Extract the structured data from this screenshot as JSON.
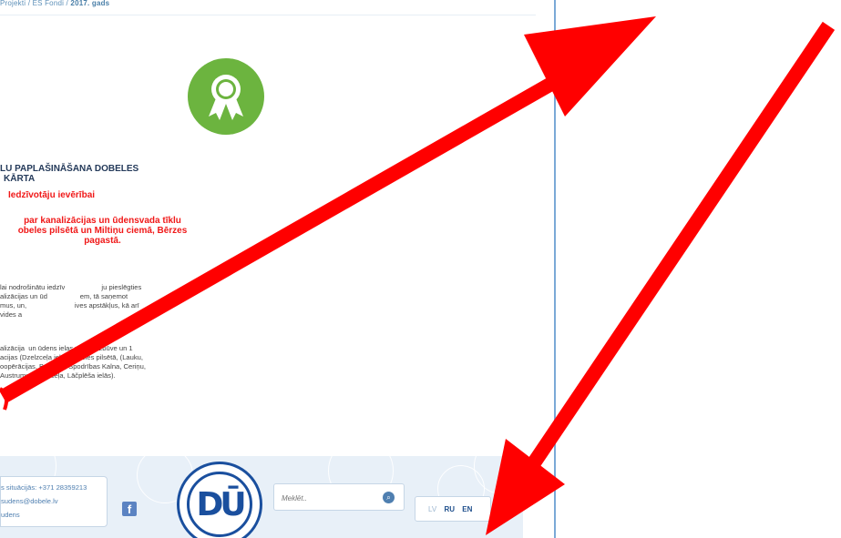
{
  "breadcrumb": {
    "item1": "Projekti",
    "sep1": "/",
    "item2": "ES Fondi",
    "sep2": "/",
    "current": "2017. gads"
  },
  "badge": {
    "icon": "award-ribbon-icon",
    "color": "#6cb43f"
  },
  "article": {
    "title_line1": "LU PAPLAŠINĀŠANA DOBELES",
    "title_line2": "KĀRTA",
    "red_subtitle": "Iedzīvotāju ievērībai",
    "red_notice_line1": "par kanalizācijas un ūdensvada tīklu",
    "red_notice_line2": "obeles pilsētā un Miltiņu ciemā, Bērzes",
    "red_notice_line3": "pagastā.",
    "para1_line1": "lai nodrošinātu iedzīv                   ju pieslēgties",
    "para1_line2": "alizācijas un ūd                 em, tā saņemot",
    "para1_line3": "mus, un,                         ives apstākļus, kā arī",
    "para1_line4": "vides a",
    "para2_line1": "alizācija  un ūdens ielas vadus  izbūve un 1",
    "para2_line2": "acijas (Dzelzceļa ielā) Dobeles pilsētā, (Lauku,",
    "para2_line3": "oopērācijas, Brīvības, Spodrības Kalna, Ceriņu,",
    "para2_line4": "Austrumu, Dzelzceļa, Lāčplēša ielās)."
  },
  "footer": {
    "emergency": "s situācijās: +371 28359213",
    "email": "sudens@dobele.lv",
    "site": "udens",
    "facebook_icon": "facebook-icon",
    "logo_text": "DŪ",
    "search_placeholder": "Meklēt..",
    "search_icon": "search-icon",
    "lang_lv": "LV",
    "lang_ru": "RU",
    "lang_en": "EN"
  },
  "colors": {
    "accent_blue": "#1a4f9e",
    "red_text": "#f01818",
    "green_badge": "#6cb43f",
    "arrow_red": "#ff0000",
    "footer_bg": "#e8f0f8"
  }
}
